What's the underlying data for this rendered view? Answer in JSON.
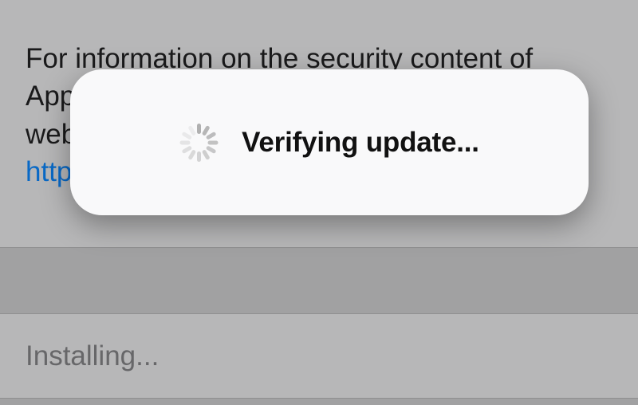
{
  "background": {
    "info_line1": "For information on the security content of",
    "info_line2_pre": "Apple",
    "info_line3_pre": "webs",
    "info_link_fragment": "https",
    "install_status": "Installing..."
  },
  "modal": {
    "message": "Verifying update..."
  }
}
